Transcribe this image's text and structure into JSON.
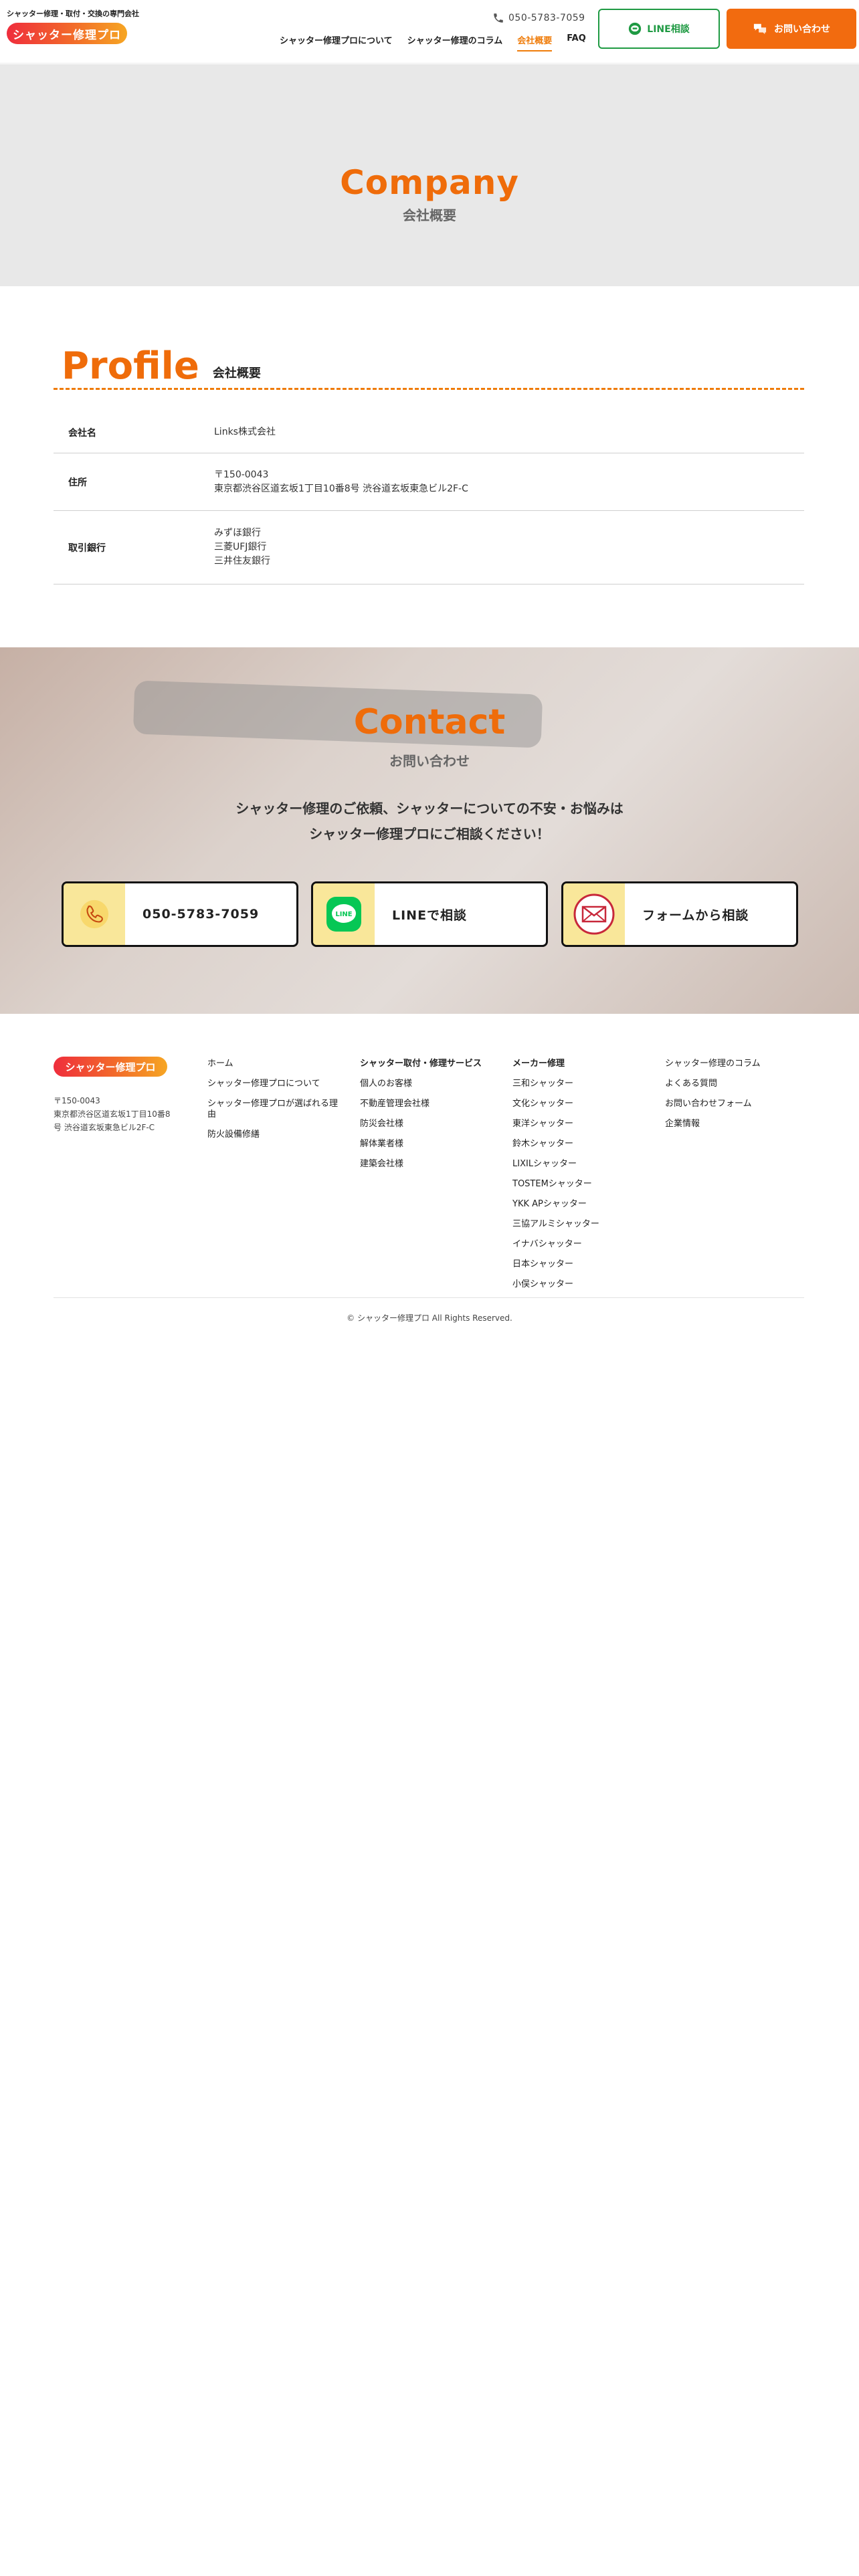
{
  "header": {
    "tagline": "シャッター修理・取付・交換の専門会社",
    "logo_text": "シャッター修理プロ",
    "phone": "050-5783-7059",
    "nav": [
      "シャッター修理プロについて",
      "シャッター修理のコラム",
      "会社概要",
      "FAQ"
    ],
    "line_button": "LINE相談",
    "contact_button": "お問い合わせ",
    "line_color": "#1f9a43",
    "accent_color": "#f26b0f"
  },
  "hero": {
    "title": "Company",
    "subtitle": "会社概要"
  },
  "profile": {
    "title": "Profile",
    "subtitle": "会社概要",
    "rows": [
      {
        "key": "会社名",
        "values": [
          "Links株式会社"
        ]
      },
      {
        "key": "住所",
        "values": [
          "〒150-0043",
          "東京都渋谷区道玄坂1丁目10番8号 渋谷道玄坂東急ビル2F-C"
        ]
      },
      {
        "key": "取引銀行",
        "values": [
          "みずほ銀行",
          "三菱UFJ銀行",
          "三井住友銀行"
        ]
      }
    ]
  },
  "contact": {
    "title": "Contact",
    "subtitle": "お問い合わせ",
    "message_line1": "シャッター修理のご依頼、シャッターについての不安・お悩みは",
    "message_line2": "シャッター修理プロにご相談ください！",
    "buttons": [
      {
        "label": "050-5783-7059",
        "icon": "phone-icon"
      },
      {
        "label": "LINEで相談",
        "icon": "line-icon"
      },
      {
        "label": "フォームから相談",
        "icon": "mail-icon"
      }
    ]
  },
  "footer": {
    "logo_text": "シャッター修理プロ",
    "address_zip": "〒150-0043",
    "address": "東京都渋谷区道玄坂1丁目10番8号 渋谷道玄坂東急ビル2F-C",
    "col1": [
      "ホーム",
      "シャッター修理プロについて",
      "シャッター修理プロが選ばれる理由",
      "防火設備修繕"
    ],
    "col2_heading": "シャッター取付・修理サービス",
    "col2": [
      "個人のお客様",
      "不動産管理会社様",
      "防災会社様",
      "解体業者様",
      "建築会社様"
    ],
    "col3_heading": "メーカー修理",
    "col3": [
      "三和シャッター",
      "文化シャッター",
      "東洋シャッター",
      "鈴木シャッター",
      "LIXILシャッター",
      "TOSTEMシャッター",
      "YKK APシャッター",
      "三協アルミシャッター",
      "イナバシャッター",
      "日本シャッター",
      "小俣シャッター"
    ],
    "col4": [
      "シャッター修理のコラム",
      "よくある質問",
      "お問い合わせフォーム",
      "企業情報"
    ],
    "copyright": "© シャッター修理プロ All Rights Reserved."
  }
}
